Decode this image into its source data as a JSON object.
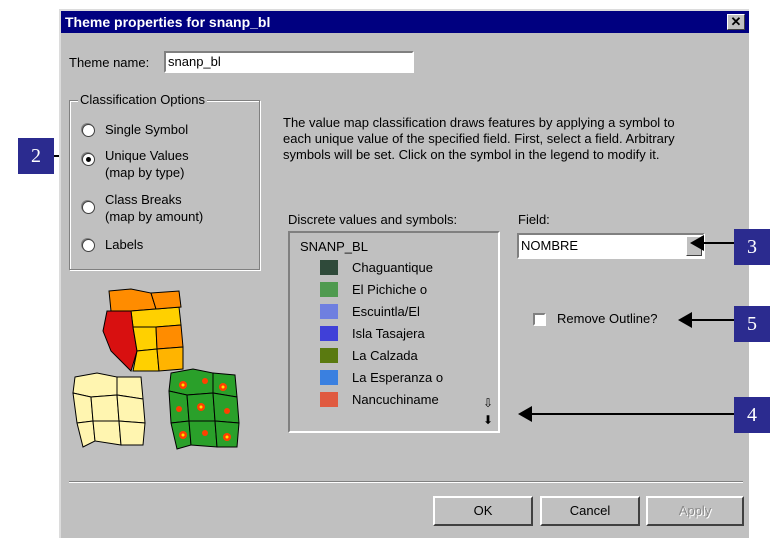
{
  "dialog": {
    "title": "Theme properties for snanp_bl",
    "close_glyph": "✕"
  },
  "theme_name": {
    "label": "Theme name:",
    "value": "snanp_bl"
  },
  "classification": {
    "group_label": "Classification Options",
    "options": [
      {
        "line1": "Single Symbol",
        "line2": "",
        "selected": false
      },
      {
        "line1": "Unique Values",
        "line2": "(map by type)",
        "selected": true
      },
      {
        "line1": "Class Breaks",
        "line2": "(map by amount)",
        "selected": false
      },
      {
        "line1": "Labels",
        "line2": "",
        "selected": false
      }
    ]
  },
  "description": {
    "line1": "The value map classification draws features by applying a symbol to",
    "line2": "each unique value of the specified field. First, select a field. Arbitrary",
    "line3": "symbols will be set. Click on the symbol in the legend to modify it."
  },
  "legend_list": {
    "label": "Discrete values and symbols:",
    "header": "SNANP_BL",
    "items": [
      {
        "label": "Chaguantique",
        "color": "#2f4a3a"
      },
      {
        "label": "El Pichiche o",
        "color": "#4f9a4f"
      },
      {
        "label": "Escuintla/El",
        "color": "#6f7fe0"
      },
      {
        "label": "Isla Tasajera",
        "color": "#4040d8"
      },
      {
        "label": "La Calzada",
        "color": "#5a7a10"
      },
      {
        "label": "La Esperanza o",
        "color": "#3a80e0"
      },
      {
        "label": "Nancuchiname",
        "color": "#e05a40"
      }
    ],
    "scroll_up_glyph": "⇩",
    "scroll_down_glyph": "⬇"
  },
  "field": {
    "label": "Field:",
    "value": "NOMBRE"
  },
  "remove_outline": {
    "label": "Remove Outline?",
    "checked": false
  },
  "buttons": {
    "ok": "OK",
    "cancel": "Cancel",
    "apply": "Apply"
  },
  "callouts": {
    "c2": "2",
    "c3": "3",
    "c4": "4",
    "c5": "5"
  }
}
